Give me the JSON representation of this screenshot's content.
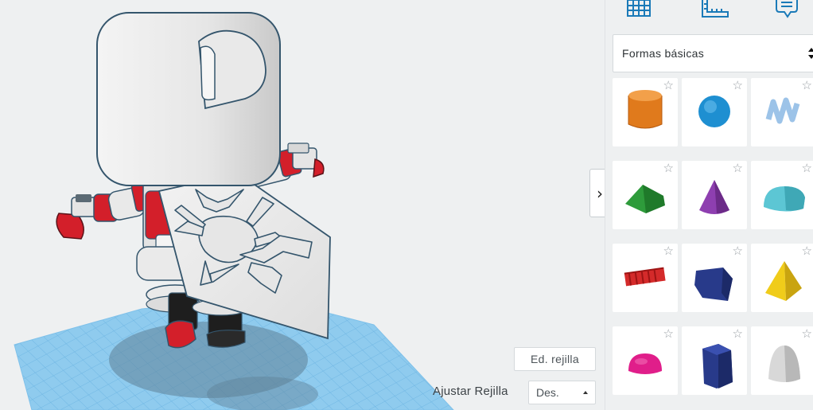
{
  "viewport": {
    "collapse_icon": "›",
    "edit_grid_label": "Ed. rejilla",
    "snap_grid_label": "Ajustar Rejilla",
    "snap_grid_value": "Des."
  },
  "panel": {
    "tabs": [
      {
        "icon": "grid-icon"
      },
      {
        "icon": "ruler-icon"
      },
      {
        "icon": "notes-icon"
      }
    ],
    "category_label": "Formas básicas",
    "shapes": [
      {
        "name": "cylinder",
        "color": "#e07a1c"
      },
      {
        "name": "sphere",
        "color": "#1e8fd1"
      },
      {
        "name": "scribble",
        "color": "#9cc3e8"
      },
      {
        "name": "roof",
        "color": "#2e9b3b"
      },
      {
        "name": "cone",
        "color": "#8e3fb0"
      },
      {
        "name": "round-roof",
        "color": "#5cc6d4"
      },
      {
        "name": "text",
        "color": "#d42a2a"
      },
      {
        "name": "box-prism",
        "color": "#283a8a"
      },
      {
        "name": "pyramid",
        "color": "#f0cc1a"
      },
      {
        "name": "half-sphere",
        "color": "#e01e8a"
      },
      {
        "name": "polygon",
        "color": "#283a8a"
      },
      {
        "name": "paraboloid",
        "color": "#d8d8d8"
      }
    ],
    "favorite_icon": "☆"
  },
  "colors": {
    "grid": "#8ecbf0",
    "accent_red": "#d31f2a",
    "body_white": "#e9e9e9",
    "outline": "#34556c"
  }
}
